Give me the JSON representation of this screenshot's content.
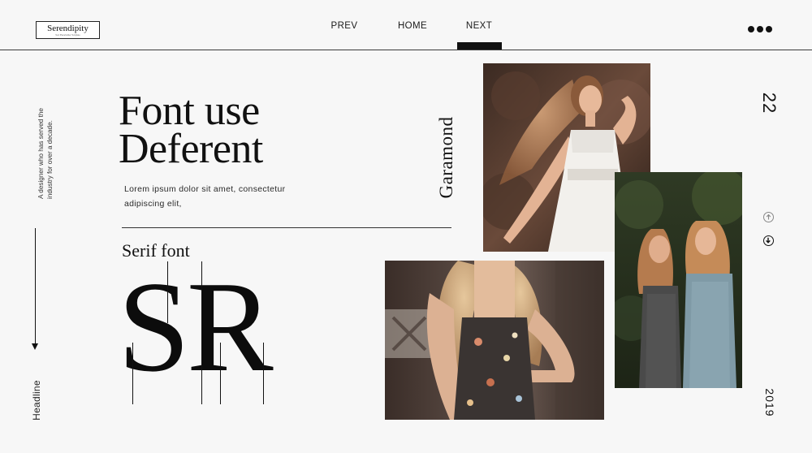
{
  "header": {
    "logo": {
      "name": "Serendipity",
      "tagline": "Text Placeholder Template"
    },
    "nav": [
      {
        "label": "PREV"
      },
      {
        "label": "HOME"
      },
      {
        "label": "NEXT"
      }
    ],
    "active_nav": "NEXT",
    "menu_icon": "more-dots-icon"
  },
  "sidebar": {
    "blurb": "A designer who has served the industry for over a decade.",
    "section_label": "Headline",
    "scroll_icon": "arrow-down-icon"
  },
  "main": {
    "title_line1": "Font use",
    "title_line2": "Deferent",
    "lorem": "Lorem ipsum dolor sit amet, consectetur adipiscing elit,",
    "font_name": "Garamond",
    "font_category": "Serif font",
    "big_letters": "SR"
  },
  "right_rail": {
    "page_number": "22",
    "up_icon": "arrow-up-circle-icon",
    "down_icon": "arrow-down-circle-icon",
    "year": "2019"
  },
  "colors": {
    "background": "#f7f7f7",
    "text": "#111111",
    "accent": "#111111"
  }
}
